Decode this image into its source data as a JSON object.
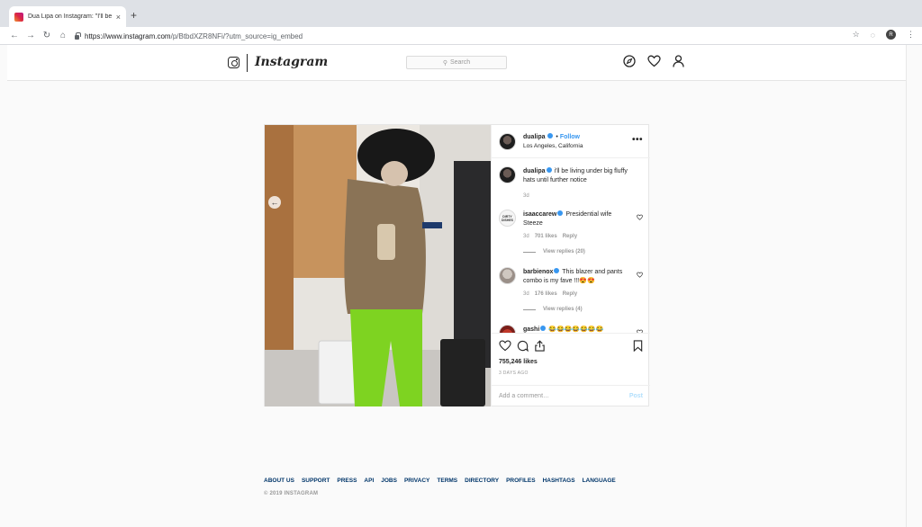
{
  "browser": {
    "tab_title": "Dua Lipa on Instagram: \"I'll be",
    "tab_close": "×",
    "new_tab": "+",
    "url_host": "https://www.instagram.com",
    "url_path": "/p/BtbdXZR8NFi/?utm_source=ig_embed",
    "profile_initial": "R"
  },
  "header": {
    "wordmark": "Instagram",
    "search_placeholder": "Search"
  },
  "post": {
    "username": "dualipa",
    "follow_label": "Follow",
    "location": "Los Angeles, California",
    "more": "•••",
    "caption": {
      "username": "dualipa",
      "text": "i'll be living under big fluffy hats until further notice",
      "time": "3d"
    },
    "comments": [
      {
        "username": "isaaccarew",
        "avatar_text": "DIRTY DISHES",
        "text": "Presidential wife Steeze",
        "time": "3d",
        "likes": "701 likes",
        "reply": "Reply",
        "view_replies": "View replies (20)"
      },
      {
        "username": "barbienox",
        "text": "This blazer and pants combo is my fave !!!😍😍",
        "time": "3d",
        "likes": "176 likes",
        "reply": "Reply",
        "view_replies": "View replies (4)"
      },
      {
        "username": "gashi",
        "text": "😂😂😂😂😂😂😂"
      }
    ],
    "likes": "755,246 likes",
    "posted": "3 DAYS AGO",
    "add_comment_placeholder": "Add a comment…",
    "post_button": "Post"
  },
  "footer": {
    "links": [
      "ABOUT US",
      "SUPPORT",
      "PRESS",
      "API",
      "JOBS",
      "PRIVACY",
      "TERMS",
      "DIRECTORY",
      "PROFILES",
      "HASHTAGS",
      "LANGUAGE"
    ],
    "copyright": "© 2019 INSTAGRAM"
  }
}
